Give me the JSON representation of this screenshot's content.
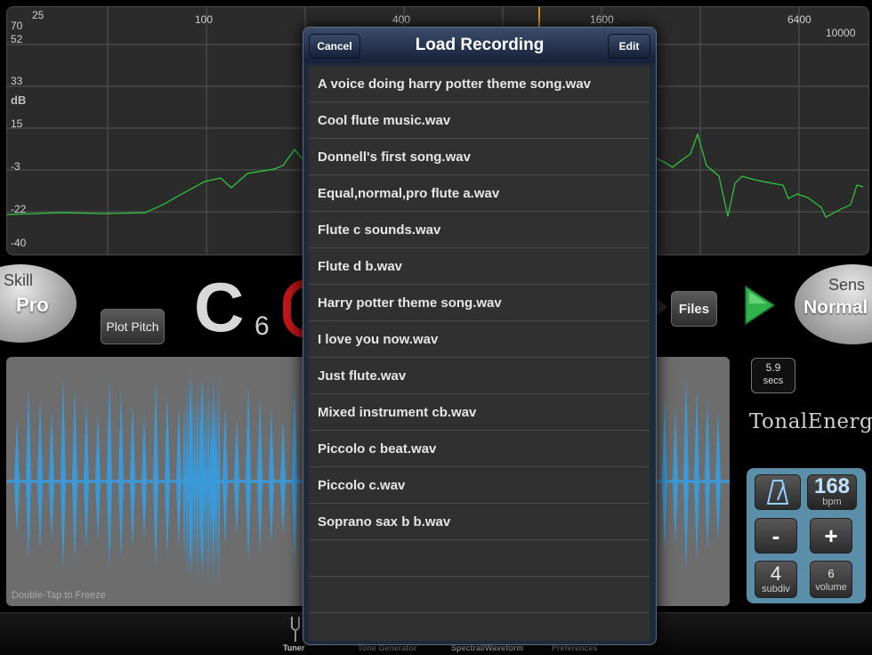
{
  "spectrum": {
    "x_ticks": [
      "25",
      "100",
      "400",
      "1600",
      "6400",
      "10000"
    ],
    "y_ticks": [
      "70",
      "52",
      "33",
      "15",
      "-3",
      "-22",
      "-40"
    ],
    "y_unit": "dB"
  },
  "skill": {
    "title": "Skill",
    "value": "Pro"
  },
  "sens": {
    "title": "Sens",
    "value": "Normal"
  },
  "plot_pitch_label": "Plot Pitch",
  "note": {
    "letter": "C",
    "octave": "6"
  },
  "files_label": "Files",
  "record_time": {
    "value": "5.9",
    "unit": "secs"
  },
  "brand": "TonalEnergy",
  "waveform_hint": "Double-Tap to Freeze",
  "metronome": {
    "bpm": "168",
    "bpm_unit": "bpm",
    "minus": "-",
    "plus": "+",
    "subdiv": "4",
    "subdiv_label": "subdiv",
    "volume": "6",
    "volume_label": "volume"
  },
  "modal": {
    "title": "Load Recording",
    "cancel_label": "Cancel",
    "edit_label": "Edit",
    "recordings": [
      "A voice doing harry potter theme song.wav",
      "Cool flute music.wav",
      "Donnell's first song.wav",
      "Equal,normal,pro flute a.wav",
      "Flute c sounds.wav",
      "Flute d b.wav",
      "Harry potter theme song.wav",
      "I love you now.wav",
      "Just flute.wav",
      "Mixed instrument cb.wav",
      "Piccolo c beat.wav",
      "Piccolo c.wav",
      "Soprano sax b b.wav"
    ]
  },
  "tabs": [
    "Tuner",
    "Tone Generator",
    "Spectral/Waveform",
    "Preferences"
  ],
  "colors": {
    "spectrum_line": "#2ecc40",
    "waveform": "#3a9ad9",
    "accent_orange": "#d4a017",
    "play_green": "#2fb34a"
  }
}
